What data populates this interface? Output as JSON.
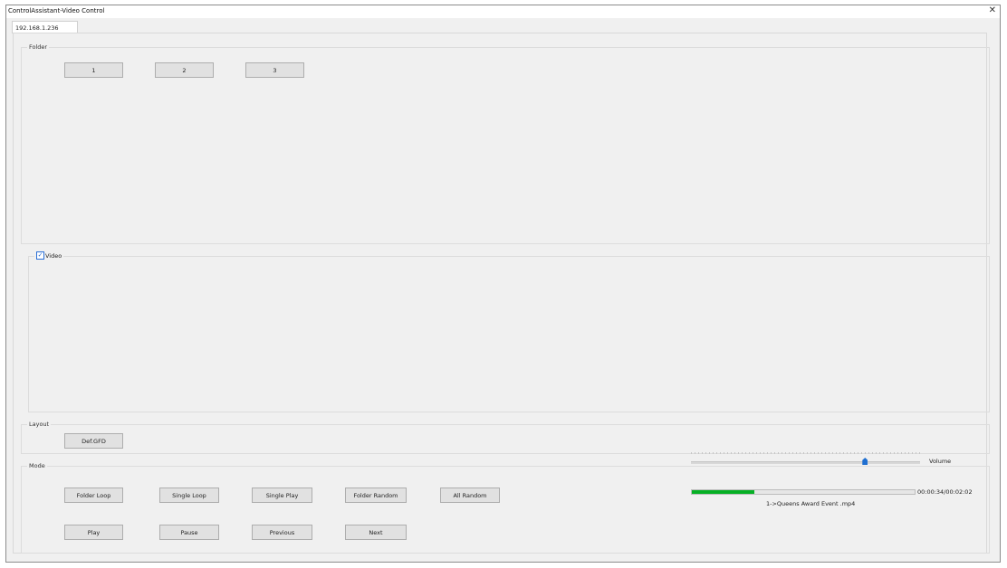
{
  "window": {
    "title": "ControlAssistant-Video Control",
    "close_glyph": "✕"
  },
  "tab": {
    "label": "192.168.1.236"
  },
  "folder": {
    "label": "Folder",
    "buttons": [
      {
        "label": "1"
      },
      {
        "label": "2"
      },
      {
        "label": "3"
      }
    ]
  },
  "video": {
    "label": "Video",
    "checked": true,
    "check_glyph": "✓"
  },
  "layout": {
    "label": "Layout",
    "button_label": "Def.GFD"
  },
  "mode": {
    "label": "Mode",
    "row1": [
      {
        "label": "Folder Loop"
      },
      {
        "label": "Single Loop"
      },
      {
        "label": "Single Play"
      },
      {
        "label": "Folder Random"
      },
      {
        "label": "All Random"
      }
    ],
    "row2": [
      {
        "label": "Play"
      },
      {
        "label": "Pause"
      },
      {
        "label": "Previous"
      },
      {
        "label": "Next"
      }
    ]
  },
  "volume": {
    "label": "Volume",
    "level": 0.76
  },
  "playback": {
    "time": "00:00:34/00:02:02",
    "file": "1->Queens Award Event .mp4",
    "progress": 0.28
  },
  "colors": {
    "progress_fill": "#06b025",
    "accent": "#1f6fd1"
  }
}
